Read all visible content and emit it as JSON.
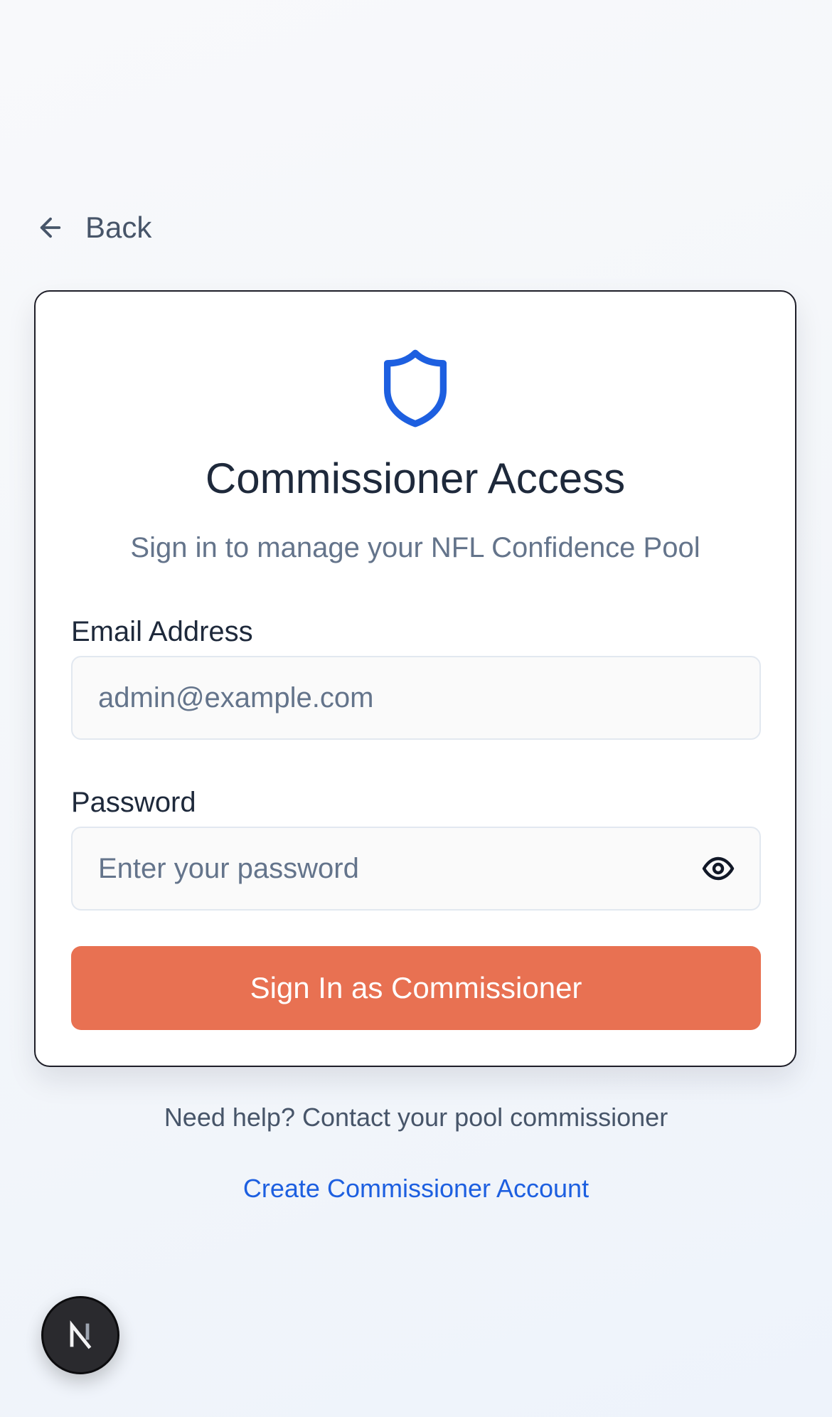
{
  "navigation": {
    "back_label": "Back",
    "back_icon": "arrow-left-icon"
  },
  "card": {
    "icon": "shield-icon",
    "title": "Commissioner Access",
    "subtitle": "Sign in to manage your NFL Confidence Pool"
  },
  "form": {
    "email": {
      "label": "Email Address",
      "value": "",
      "placeholder": "admin@example.com"
    },
    "password": {
      "label": "Password",
      "value": "",
      "placeholder": "Enter your password",
      "toggle_icon": "eye-icon"
    },
    "submit_label": "Sign In as Commissioner"
  },
  "footer": {
    "help_text": "Need help? Contact your pool commissioner",
    "create_account_label": "Create Commissioner Account"
  },
  "dev_badge": {
    "icon": "nextjs-logo-icon"
  },
  "colors": {
    "accent_blue": "#1d5fe0",
    "button_coral": "#e87152",
    "title_text": "#1e293b",
    "muted_text": "#64748b"
  }
}
